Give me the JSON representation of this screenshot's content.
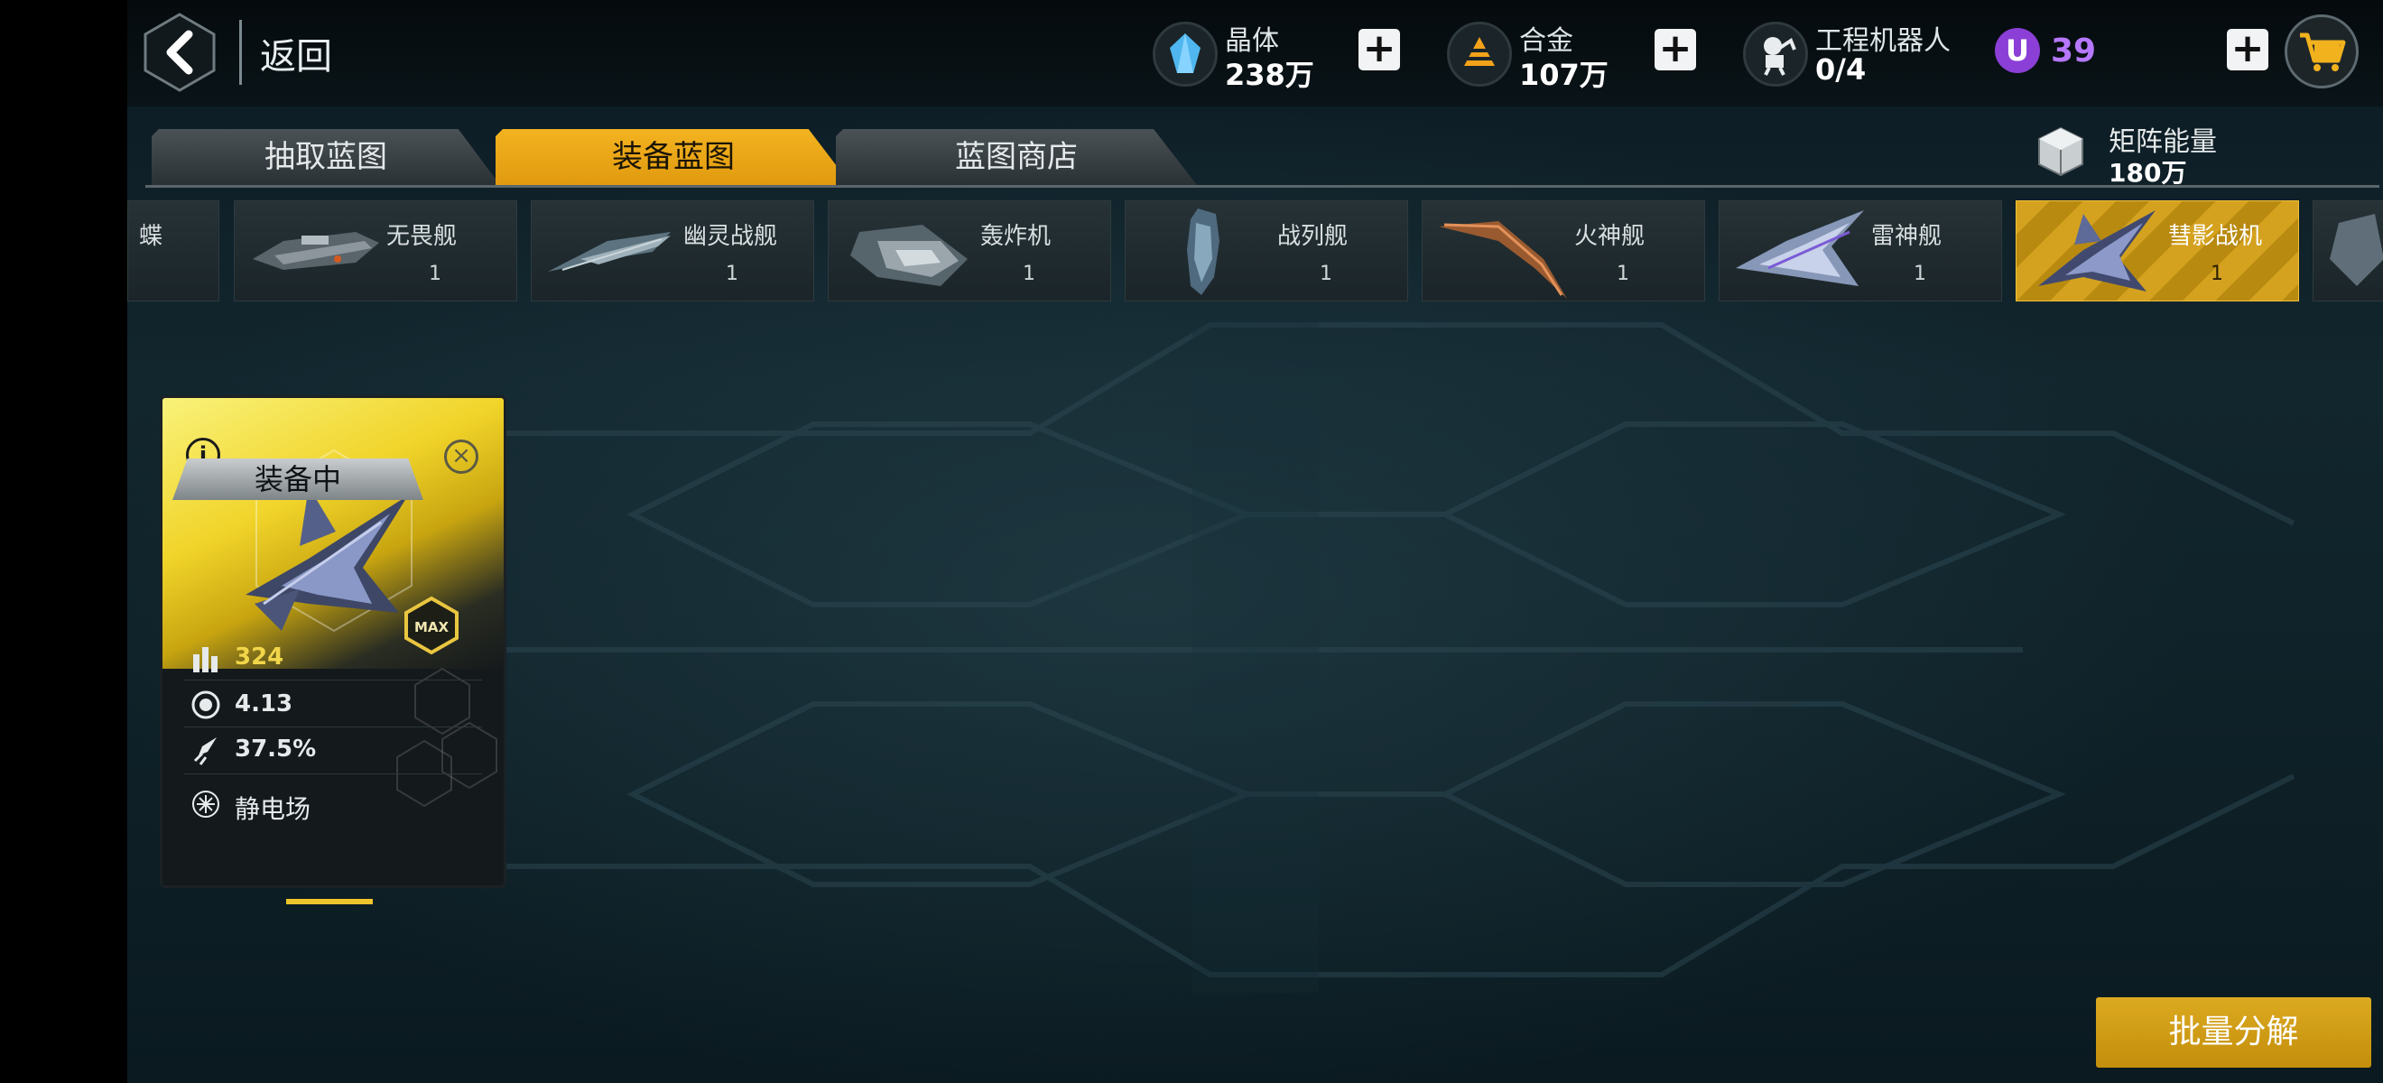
{
  "header": {
    "back_label": "返回",
    "resources": [
      {
        "name": "晶体",
        "value": "238万",
        "icon": "crystal-icon"
      },
      {
        "name": "合金",
        "value": "107万",
        "icon": "alloy-icon"
      },
      {
        "name": "工程机器人",
        "value": "0/4",
        "icon": "robot-icon"
      }
    ],
    "premium": {
      "badge": "U",
      "value": "39",
      "color": "#b678ff"
    },
    "plus_label": "+"
  },
  "tabs": [
    {
      "label": "抽取蓝图",
      "active": false
    },
    {
      "label": "装备蓝图",
      "active": true
    },
    {
      "label": "蓝图商店",
      "active": false
    }
  ],
  "matrix_energy": {
    "name": "矩阵能量",
    "value": "180万"
  },
  "ships": [
    {
      "name": "无畏舰",
      "count": "1",
      "active": false
    },
    {
      "name": "幽灵战舰",
      "count": "1",
      "active": false
    },
    {
      "name": "轰炸机",
      "count": "1",
      "active": false
    },
    {
      "name": "战列舰",
      "count": "1",
      "active": false
    },
    {
      "name": "火神舰",
      "count": "1",
      "active": false
    },
    {
      "name": "雷神舰",
      "count": "1",
      "active": false
    },
    {
      "name": "彗影战机",
      "count": "1",
      "active": true
    }
  ],
  "partial_ship_label": "蝶",
  "blueprint": {
    "info_label": "i",
    "close_label": "×",
    "max_label": "MAX",
    "stats": [
      {
        "icon": "ammo-icon",
        "value": "324",
        "color": "#f2d64a"
      },
      {
        "icon": "reactor-icon",
        "value": "4.13",
        "color": "#e6eaeb"
      },
      {
        "icon": "engine-icon",
        "value": "37.5%",
        "color": "#e6eaeb"
      }
    ],
    "ability": {
      "icon": "burst-icon",
      "label": "静电场"
    },
    "status": "装备中"
  },
  "bulk_button": "批量分解",
  "colors": {
    "accent": "#f0b21c",
    "premium": "#8b3fd6"
  }
}
